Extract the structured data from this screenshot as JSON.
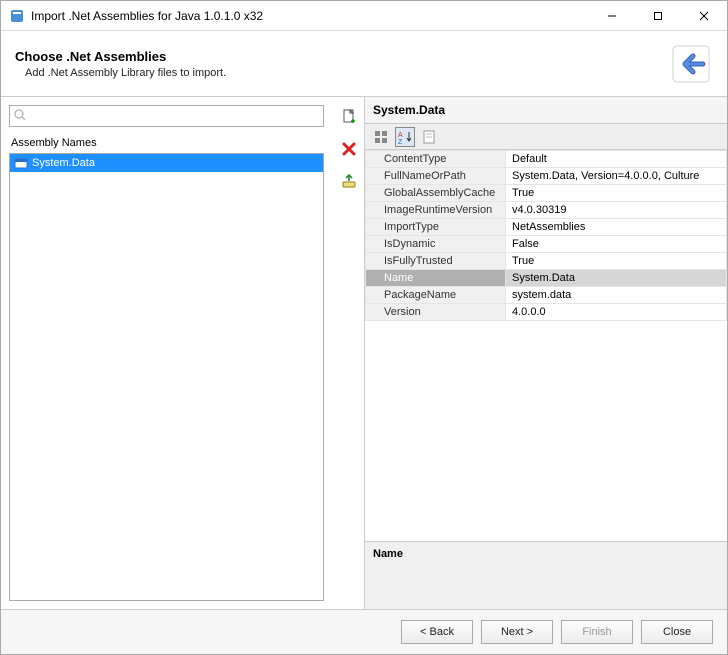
{
  "titlebar": {
    "title": "Import .Net Assemblies for Java 1.0.1.0 x32"
  },
  "header": {
    "heading": "Choose .Net Assemblies",
    "sub": "Add .Net Assembly Library files to import."
  },
  "left": {
    "search_placeholder": "",
    "list_label": "Assembly Names",
    "items": [
      {
        "label": "System.Data"
      }
    ]
  },
  "right": {
    "title": "System.Data",
    "props": [
      {
        "name": "ContentType",
        "value": "Default"
      },
      {
        "name": "FullNameOrPath",
        "value": "System.Data, Version=4.0.0.0, Culture"
      },
      {
        "name": "GlobalAssemblyCache",
        "value": "True"
      },
      {
        "name": "ImageRuntimeVersion",
        "value": "v4.0.30319"
      },
      {
        "name": "ImportType",
        "value": "NetAssemblies"
      },
      {
        "name": "IsDynamic",
        "value": "False"
      },
      {
        "name": "IsFullyTrusted",
        "value": "True"
      },
      {
        "name": "Name",
        "value": "System.Data",
        "selected": true
      },
      {
        "name": "PackageName",
        "value": "system.data"
      },
      {
        "name": "Version",
        "value": "4.0.0.0"
      }
    ],
    "desc_label": "Name"
  },
  "footer": {
    "back": "< Back",
    "next": "Next >",
    "finish": "Finish",
    "close": "Close"
  }
}
